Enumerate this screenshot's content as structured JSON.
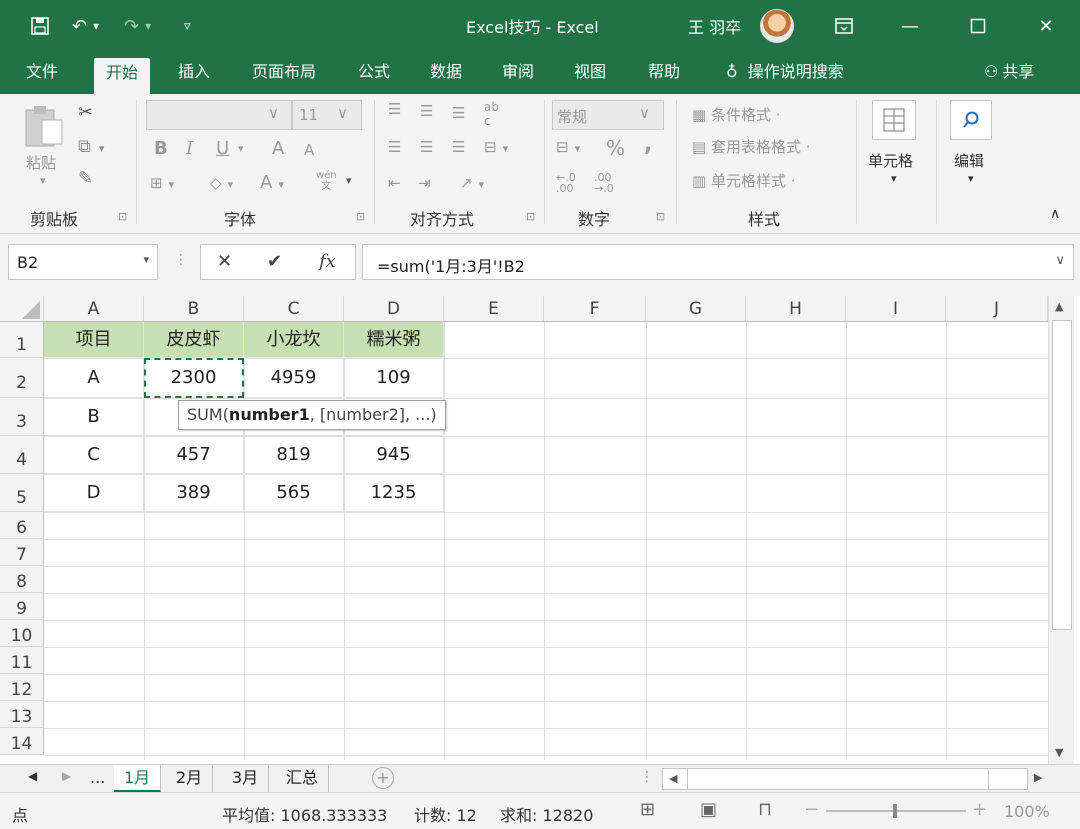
{
  "titlebar": {
    "title": "Excel技巧  -  Excel",
    "user": "王 羽卒",
    "bg": "#217346"
  },
  "tabs": [
    "文件",
    "开始",
    "插入",
    "页面布局",
    "公式",
    "数据",
    "审阅",
    "视图",
    "帮助"
  ],
  "tell_me": "操作说明搜索",
  "share": "共享",
  "ribbon": {
    "clipboard": {
      "label": "剪贴板",
      "paste": "粘贴"
    },
    "font": {
      "label": "字体",
      "size": "11",
      "bold": "B",
      "italic": "I",
      "underline": "U",
      "grow": "A",
      "shrink": "A",
      "color": "A",
      "wen": "wén"
    },
    "align": {
      "label": "对齐方式"
    },
    "number": {
      "label": "数字",
      "format": "常规",
      "percent": "%",
      "comma": ","
    },
    "styles": {
      "label": "样式",
      "cond": "条件格式 ·",
      "table": "套用表格格式 ·",
      "cell": "单元格样式 ·"
    },
    "cells": {
      "label": "单元格"
    },
    "edit": {
      "label": "编辑"
    }
  },
  "formula_bar": {
    "name_box": "B2",
    "formula": "=sum('1月:3月'!B2",
    "fx": "fx"
  },
  "grid": {
    "columns": [
      "A",
      "B",
      "C",
      "D",
      "E",
      "F",
      "G",
      "H",
      "I",
      "J"
    ],
    "rows": [
      "1",
      "2",
      "3",
      "4",
      "5",
      "6",
      "7",
      "8",
      "9",
      "10",
      "11",
      "12",
      "13",
      "14"
    ],
    "header_row": [
      "项目",
      "皮皮虾",
      "小龙坎",
      "糯米粥"
    ],
    "data": [
      [
        "A",
        "2300",
        "4959",
        "109"
      ],
      [
        "B",
        "",
        "",
        ""
      ],
      [
        "C",
        "457",
        "819",
        "945"
      ],
      [
        "D",
        "389",
        "565",
        "1235"
      ]
    ],
    "header_fill": "#c6e0b4"
  },
  "tooltip": {
    "fn": "SUM(",
    "arg1": "number1",
    "rest": ", [number2], ...)"
  },
  "sheets": {
    "ellipsis": "...",
    "tabs": [
      "1月",
      "2月",
      "3月",
      "汇总"
    ],
    "active": "1月"
  },
  "status": {
    "mode": "点",
    "avg": "平均值: 1068.333333",
    "count": "计数: 12",
    "sum": "求和: 12820",
    "zoom": "100%"
  }
}
